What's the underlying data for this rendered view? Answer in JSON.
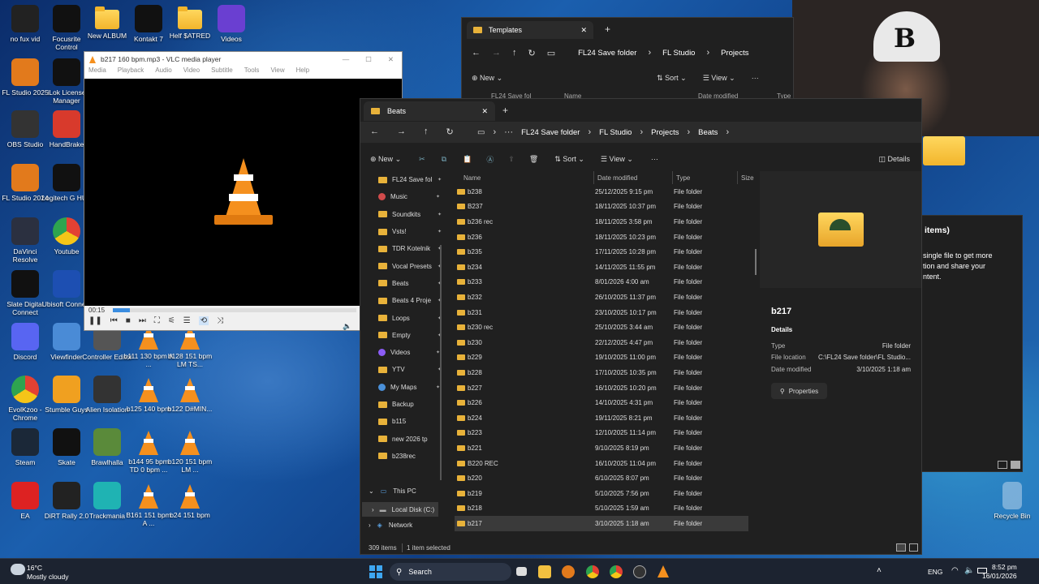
{
  "desktop_icons": [
    {
      "label": "no fux vid",
      "x": "0"
    },
    {
      "label": "Focusrite Control"
    },
    {
      "label": "New ALBUM"
    },
    {
      "label": "Kontakt 7"
    },
    {
      "label": "Helf $ATRED"
    },
    {
      "label": "Videos"
    },
    {
      "label": "FL Studio 2025"
    },
    {
      "label": "iLok License Manager"
    },
    {
      "label": "OBS Studio"
    },
    {
      "label": "HandBrake"
    },
    {
      "label": "FL Studio 2024"
    },
    {
      "label": "Logitech G HUB"
    },
    {
      "label": "DaVinci Resolve"
    },
    {
      "label": "Youtube"
    },
    {
      "label": "Slate Digital Connect"
    },
    {
      "label": "Ubisoft Connect"
    },
    {
      "label": "Discord"
    },
    {
      "label": "Viewfinder"
    },
    {
      "label": "Controller Editor"
    },
    {
      "label": "b111 130 bpm A ..."
    },
    {
      "label": "b128 151 bpm LM TS..."
    },
    {
      "label": "EvolKzoo - Chrome"
    },
    {
      "label": "Stumble Guys"
    },
    {
      "label": "Alien Isolation"
    },
    {
      "label": "b125 140 bpm"
    },
    {
      "label": "b122 D#MIN..."
    },
    {
      "label": "Steam"
    },
    {
      "label": "Skate"
    },
    {
      "label": "Brawlhalla"
    },
    {
      "label": "b144 95 bpm TD 0 bpm ..."
    },
    {
      "label": "b120 151 bpm LM ..."
    },
    {
      "label": "EA"
    },
    {
      "label": "DiRT Rally 2.0"
    },
    {
      "label": "Trackmania"
    },
    {
      "label": "B161 151 bpm A ..."
    },
    {
      "label": "b24 151 bpm"
    },
    {
      "label": "Recycle Bin"
    }
  ],
  "vlc": {
    "title": "b217 160 bpm.mp3 - VLC media player",
    "menu": [
      "Media",
      "Playback",
      "Audio",
      "Video",
      "Subtitle",
      "Tools",
      "View",
      "Help"
    ],
    "time": "00:15",
    "progress": 0.07,
    "volume_icon": "speaker-icon"
  },
  "explorer_back": {
    "tab": "Templates",
    "crumbs": [
      "FL24 Save folder",
      "FL Studio",
      "Projects"
    ],
    "toolbar": {
      "new": "New",
      "sort": "Sort",
      "view": "View"
    },
    "cols": [
      "Name",
      "Date modified",
      "Type"
    ],
    "nav_partial": "FL24 Save fol"
  },
  "explorer": {
    "tab": "Beats",
    "crumbs": [
      "FL24 Save folder",
      "FL Studio",
      "Projects",
      "Beats"
    ],
    "toolbar": {
      "new": "New",
      "sort": "Sort",
      "view": "View",
      "details": "Details"
    },
    "columns": [
      "Name",
      "Date modified",
      "Type",
      "Size"
    ],
    "nav": [
      "FL24 Save fol",
      "Music",
      "Soundkits",
      "Vsts!",
      "TDR Kotelnik",
      "Vocal Presets",
      "Beats",
      "Beats 4 Proje",
      "Loops",
      "Empty",
      "Videos",
      "YTV",
      "My Maps",
      "Backup",
      "b115",
      "new 2026 tp",
      "b238rec"
    ],
    "nav_bottom": [
      "This PC",
      "Local Disk (C:)",
      "Network"
    ],
    "rows": [
      [
        "b238",
        "25/12/2025 9:15 pm",
        "File folder"
      ],
      [
        "B237",
        "18/11/2025 10:37 pm",
        "File folder"
      ],
      [
        "b236 rec",
        "18/11/2025 3:58 pm",
        "File folder"
      ],
      [
        "b236",
        "18/11/2025 10:23 pm",
        "File folder"
      ],
      [
        "b235",
        "17/11/2025 10:28 pm",
        "File folder"
      ],
      [
        "b234",
        "14/11/2025 11:55 pm",
        "File folder"
      ],
      [
        "b233",
        "8/01/2026 4:00 am",
        "File folder"
      ],
      [
        "b232",
        "26/10/2025 11:37 pm",
        "File folder"
      ],
      [
        "b231",
        "23/10/2025 10:17 pm",
        "File folder"
      ],
      [
        "b230 rec",
        "25/10/2025 3:44 am",
        "File folder"
      ],
      [
        "b230",
        "22/12/2025 4:47 pm",
        "File folder"
      ],
      [
        "b229",
        "19/10/2025 11:00 pm",
        "File folder"
      ],
      [
        "b228",
        "17/10/2025 10:35 pm",
        "File folder"
      ],
      [
        "b227",
        "16/10/2025 10:20 pm",
        "File folder"
      ],
      [
        "b226",
        "14/10/2025 4:31 pm",
        "File folder"
      ],
      [
        "b224",
        "19/11/2025 8:21 pm",
        "File folder"
      ],
      [
        "b223",
        "12/10/2025 11:14 pm",
        "File folder"
      ],
      [
        "b221",
        "9/10/2025 8:19 pm",
        "File folder"
      ],
      [
        "B220 REC",
        "16/10/2025 11:04 pm",
        "File folder"
      ],
      [
        "b220",
        "6/10/2025 8:07 pm",
        "File folder"
      ],
      [
        "b219",
        "5/10/2025 7:56 pm",
        "File folder"
      ],
      [
        "b218",
        "5/10/2025 1:59 am",
        "File folder"
      ],
      [
        "b217",
        "3/10/2025 1:18 am",
        "File folder"
      ]
    ],
    "status_items": "309 items",
    "status_selected": "1 item selected",
    "details": {
      "name": "b217",
      "heading": "Details",
      "type_label": "Type",
      "type_value": "File folder",
      "location_label": "File location",
      "location_value": "C:\\FL24 Save folder\\FL Studio...",
      "date_label": "Date modified",
      "date_value": "3/10/2025 1:18 am",
      "properties": "Properties"
    }
  },
  "bg_panel": {
    "title": "items)",
    "line1": "single file to get more",
    "line2": "tion and share your",
    "line3": "ntent."
  },
  "taskbar": {
    "weather_temp": "16°C",
    "weather_desc": "Mostly cloudy",
    "search": "Search",
    "lang": "ENG",
    "time": "8:52 pm",
    "date": "16/01/2026"
  }
}
